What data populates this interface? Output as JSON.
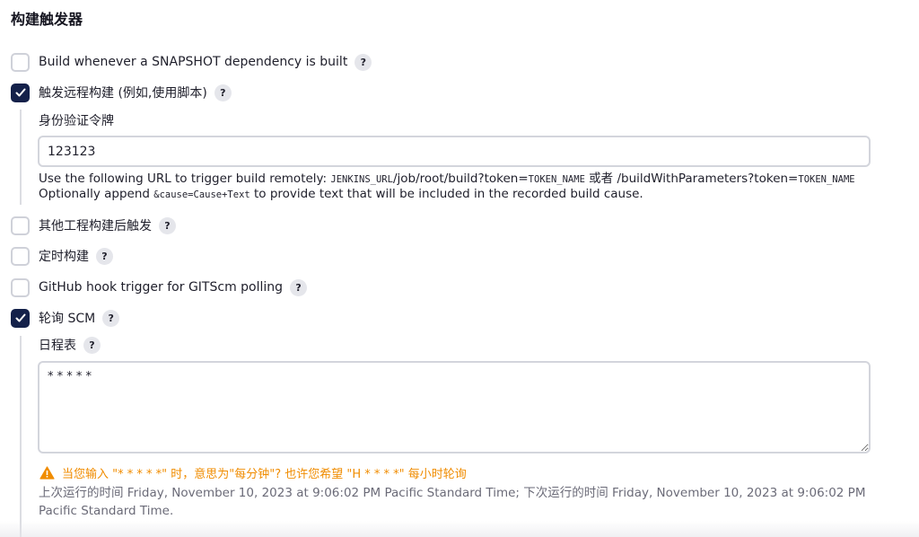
{
  "section": {
    "title": "构建触发器"
  },
  "triggers": {
    "snapshot": {
      "label": "Build whenever a SNAPSHOT dependency is built",
      "checked": false
    },
    "remote": {
      "label": "触发远程构建 (例如,使用脚本)",
      "checked": true,
      "token_label": "身份验证令牌",
      "token_value": "123123",
      "desc_line1_prefix": "Use the following URL to trigger build remotely: ",
      "desc_line1_code1": "JENKINS_URL",
      "desc_line1_mid": "/job/root/build?token=",
      "desc_line1_code2": "TOKEN_NAME",
      "desc_line1_or": " 或者 /buildWithParameters?token=",
      "desc_line1_code3": "TOKEN_NAME",
      "desc_line2_prefix": "Optionally append ",
      "desc_line2_code": "&cause=Cause+Text",
      "desc_line2_suffix": " to provide text that will be included in the recorded build cause."
    },
    "other_project": {
      "label": "其他工程构建后触发",
      "checked": false
    },
    "periodic": {
      "label": "定时构建",
      "checked": false
    },
    "github_hook": {
      "label": "GitHub hook trigger for GITScm polling",
      "checked": false
    },
    "poll_scm": {
      "label": "轮询 SCM",
      "checked": true,
      "schedule_label": "日程表",
      "schedule_value": "* * * * *",
      "warning": "当您输入 \"* * * * *\" 时，意思为\"每分钟\"? 也许您希望 \"H * * * *\" 每小时轮询",
      "info": "上次运行的时间 Friday, November 10, 2023 at 9:06:02 PM Pacific Standard Time; 下次运行的时间 Friday, November 10, 2023 at 9:06:02 PM Pacific Standard Time."
    }
  },
  "help_glyph": "?",
  "colors": {
    "checked": "#14214a",
    "warning": "#f08c00",
    "muted": "#6b6b78"
  }
}
